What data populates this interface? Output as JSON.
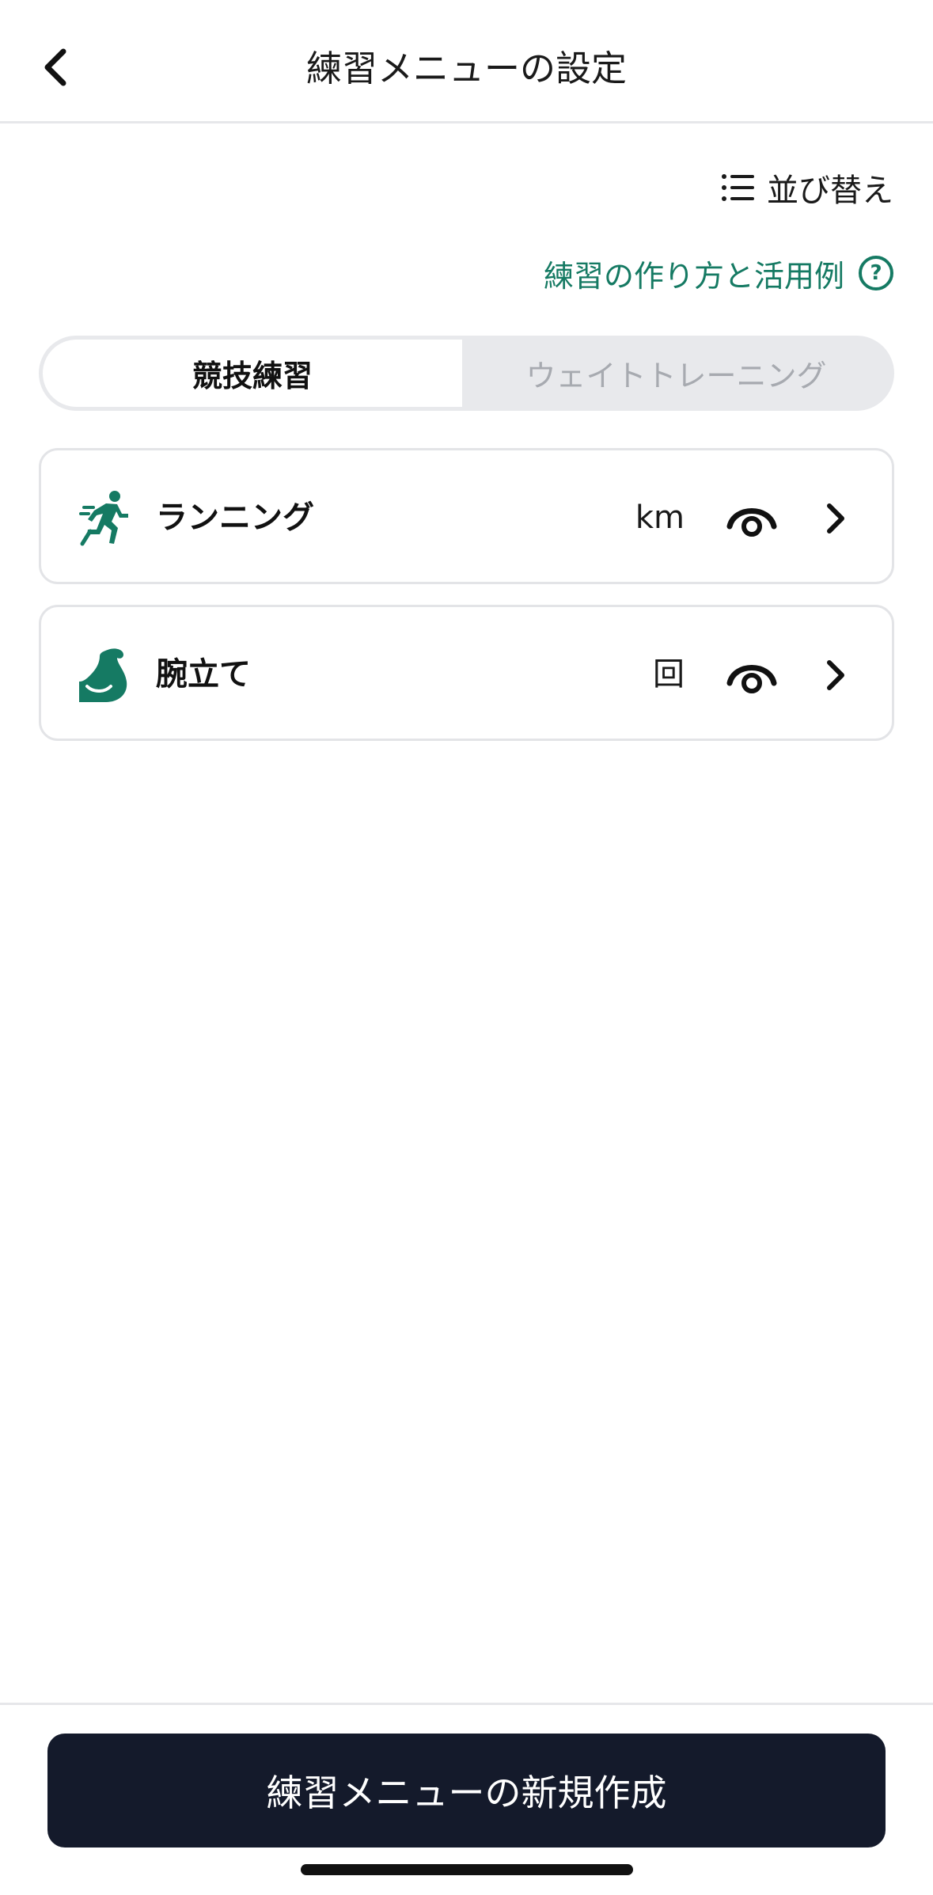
{
  "header": {
    "title": "練習メニューの設定"
  },
  "sort": {
    "label": "並び替え"
  },
  "help": {
    "label": "練習の作り方と活用例"
  },
  "tabs": [
    {
      "label": "競技練習",
      "selected": true
    },
    {
      "label": "ウェイトトレーニング",
      "selected": false
    }
  ],
  "items": [
    {
      "name": "ランニング",
      "unit": "km",
      "icon": "running-icon",
      "visible": true
    },
    {
      "name": "腕立て",
      "unit": "回",
      "icon": "flexed-biceps-icon",
      "visible": true
    }
  ],
  "footer": {
    "create_label": "練習メニューの新規作成"
  },
  "colors": {
    "accent": "#157a63",
    "button_bg": "#141a2b",
    "segment_bg": "#e8e9ec",
    "inactive_text": "#a7aab0"
  }
}
